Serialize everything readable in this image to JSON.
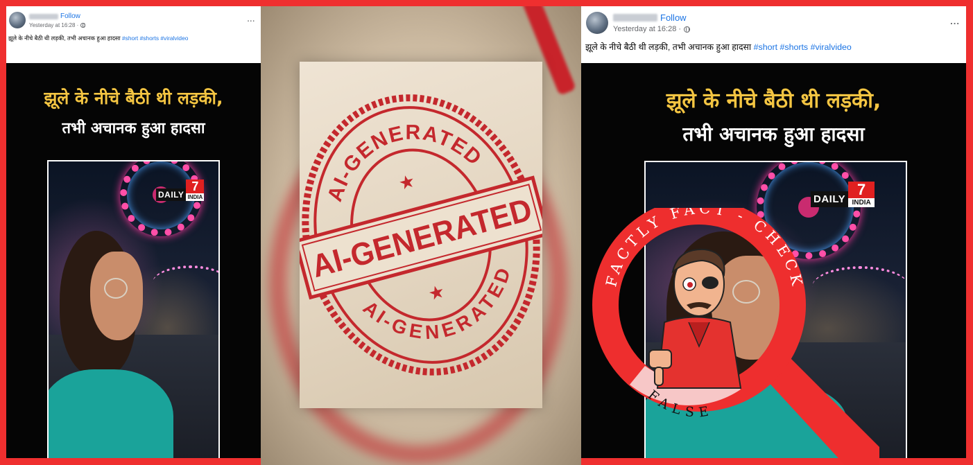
{
  "posts": {
    "left": {
      "follow_label": "Follow",
      "timestamp": "Yesterday at 16:28 ·",
      "more_label": "...",
      "caption_text": "झूले के नीचे बैठी थी लड़की, तभी अचानक हुआ हादसा",
      "hashtags": "#short #shorts #viralvideo",
      "headline_line1": "झूले के नीचे बैठी थी लड़की,",
      "headline_line2": "तभी अचानक हुआ हादसा"
    },
    "right": {
      "follow_label": "Follow",
      "timestamp": "Yesterday at 16:28 ·",
      "more_label": "...",
      "caption_text": "झूले के नीचे बैठी थी लड़की, तभी अचानक हुआ हादसा",
      "hashtags": "#short #shorts #viralvideo",
      "headline_line1": "झूले के नीचे बैठी थी लड़की,",
      "headline_line2": "तभी अचानक हुआ हादसा"
    }
  },
  "logo": {
    "daily": "DAILY",
    "seven": "7",
    "india": "INDIA"
  },
  "stamp": {
    "center_text": "AI-GENERATED",
    "arc_top_text": "AI-GENERATED",
    "arc_bottom_text": "AI-GENERATED",
    "color": "#c4282d"
  },
  "badge": {
    "arc_text": "FACTLY FACT - CHECK",
    "verdict": "FALSE",
    "ring_color": "#ee2e2e"
  },
  "colors": {
    "background": "#ef2f2f",
    "link": "#1b74e4",
    "headline_yellow": "#f4c542"
  }
}
